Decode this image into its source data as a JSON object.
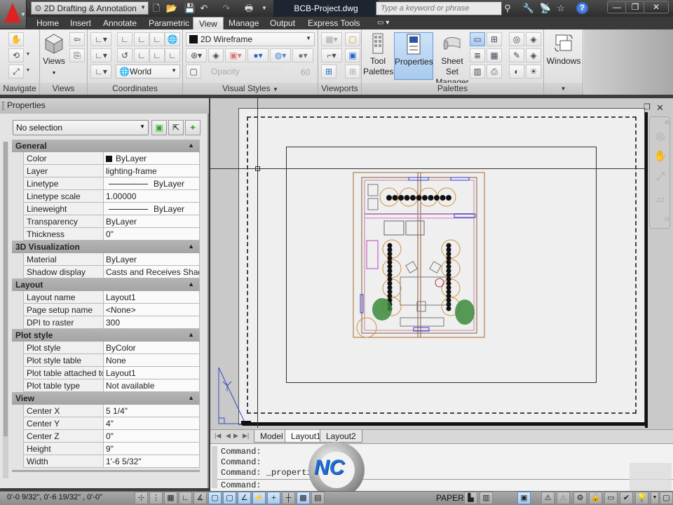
{
  "titlebar": {
    "app_menu_icon": "autocad-logo-icon",
    "workspace": "2D Drafting & Annotation",
    "quick_access": [
      "new-icon",
      "open-icon",
      "save-icon",
      "undo-icon",
      "redo-icon",
      "plot-icon",
      "customize-dropdown-icon"
    ],
    "document_title": "BCB-Project.dwg",
    "search_placeholder": "Type a keyword or phrase",
    "tools": [
      "binoculars-icon",
      "wrench-icon",
      "satellite-icon",
      "star-icon",
      "help-icon"
    ],
    "window_controls": [
      "minimize-icon",
      "restore-icon",
      "close-icon"
    ]
  },
  "ribbon_tabs": [
    {
      "label": "Home"
    },
    {
      "label": "Insert"
    },
    {
      "label": "Annotate"
    },
    {
      "label": "Parametric"
    },
    {
      "label": "View",
      "active": true
    },
    {
      "label": "Manage"
    },
    {
      "label": "Output"
    },
    {
      "label": "Express Tools"
    }
  ],
  "ribbon": {
    "navigate": {
      "title": "Navigate"
    },
    "views": {
      "title": "Views",
      "button": "Views"
    },
    "coordinates": {
      "title": "Coordinates",
      "ucs_combo": "World"
    },
    "visual_styles": {
      "title": "Visual Styles",
      "style_combo": "2D Wireframe",
      "opacity_label": "Opacity",
      "opacity_value": "60"
    },
    "viewports": {
      "title": "Viewports"
    },
    "palettes": {
      "title": "Palettes",
      "tool_palettes": "Tool Palettes",
      "properties": "Properties",
      "sheet_set": "Sheet Set Manager"
    },
    "windows": {
      "button": "Windows"
    }
  },
  "properties": {
    "title": "Properties",
    "selection": "No selection",
    "sections": {
      "general": {
        "title": "General",
        "rows": [
          {
            "key": "Color",
            "value": "ByLayer"
          },
          {
            "key": "Layer",
            "value": "lighting-frame"
          },
          {
            "key": "Linetype",
            "value": "ByLayer"
          },
          {
            "key": "Linetype scale",
            "value": "1.00000"
          },
          {
            "key": "Lineweight",
            "value": "ByLayer"
          },
          {
            "key": "Transparency",
            "value": "ByLayer"
          },
          {
            "key": "Thickness",
            "value": "0\""
          }
        ]
      },
      "viz3d": {
        "title": "3D Visualization",
        "rows": [
          {
            "key": "Material",
            "value": "ByLayer"
          },
          {
            "key": "Shadow display",
            "value": "Casts and Receives Shad..."
          }
        ]
      },
      "layout": {
        "title": "Layout",
        "rows": [
          {
            "key": "Layout name",
            "value": "Layout1"
          },
          {
            "key": "Page setup name",
            "value": "<None>"
          },
          {
            "key": "DPI to raster",
            "value": "300"
          }
        ]
      },
      "plot_style": {
        "title": "Plot style",
        "rows": [
          {
            "key": "Plot style",
            "value": "ByColor"
          },
          {
            "key": "Plot style table",
            "value": "None"
          },
          {
            "key": "Plot table attached to",
            "value": "Layout1"
          },
          {
            "key": "Plot table type",
            "value": "Not available"
          }
        ]
      },
      "view": {
        "title": "View",
        "rows": [
          {
            "key": "Center X",
            "value": "5 1/4\""
          },
          {
            "key": "Center Y",
            "value": "4\""
          },
          {
            "key": "Center Z",
            "value": "0\""
          },
          {
            "key": "Height",
            "value": "9\""
          },
          {
            "key": "Width",
            "value": "1'-6 5/32\""
          }
        ]
      }
    }
  },
  "layout_tabs": [
    {
      "label": "Model"
    },
    {
      "label": "Layout1",
      "active": true
    },
    {
      "label": "Layout2"
    }
  ],
  "command_line": {
    "history": [
      "Command:",
      "Command:",
      "Command:  _properties"
    ],
    "prompt": "Command:"
  },
  "status": {
    "coordinates": "0'-0 9/32\",  0'-6 19/32\" , 0'-0\"",
    "space": "PAPER"
  },
  "watermark": "NC"
}
